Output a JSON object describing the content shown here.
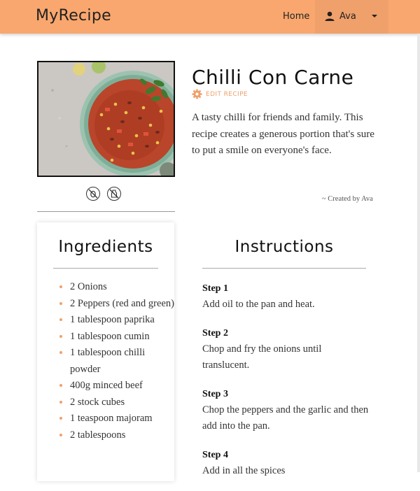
{
  "navbar": {
    "brand": "MyRecipe",
    "home_label": "Home",
    "user_name": "Ava"
  },
  "colors": {
    "navbar": "#f9a76e",
    "accent": "#f0a06a"
  },
  "recipe": {
    "title": "Chilli Con Carne",
    "edit_label": "EDIT RECIPE",
    "description": "A tasty chilli for friends and family. This recipe creates a generous portion that's sure to put a smile on everyone's face.",
    "created_by": "~ Created by Ava",
    "badges": [
      "no-nuts-icon",
      "no-dairy-icon"
    ]
  },
  "ingredients": {
    "heading": "Ingredients",
    "items": [
      "2 Onions",
      "2 Peppers (red and green)",
      "1 tablespoon paprika",
      "1 tablespoon cumin",
      "1 tablespoon chilli powder",
      "400g minced beef",
      "2 stock cubes",
      "1 teaspoon majoram",
      "2 tablespoons"
    ]
  },
  "instructions": {
    "heading": "Instructions",
    "steps": [
      {
        "label": "Step 1",
        "text": "Add oil to the pan and heat."
      },
      {
        "label": "Step 2",
        "text": "Chop and fry the onions until translucent."
      },
      {
        "label": "Step 3",
        "text": "Chop the peppers and the garlic and then add into the pan."
      },
      {
        "label": "Step 4",
        "text": "Add in all the spices"
      }
    ]
  }
}
